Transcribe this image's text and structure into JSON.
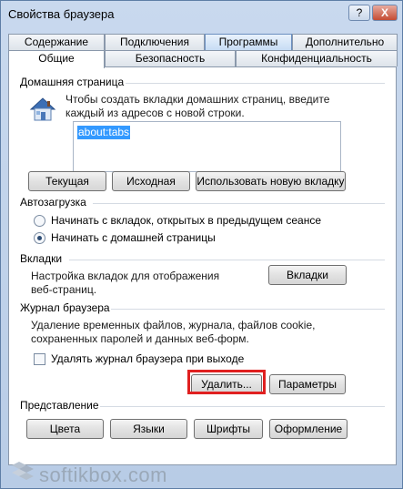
{
  "window": {
    "title": "Свойства браузера",
    "help_label": "?",
    "close_label": "X"
  },
  "tabs": {
    "row1": [
      "Содержание",
      "Подключения",
      "Программы",
      "Дополнительно"
    ],
    "row2": [
      "Общие",
      "Безопасность",
      "Конфиденциальность"
    ],
    "selected": "Общие"
  },
  "home": {
    "group_title": "Домашняя страница",
    "description": "Чтобы создать вкладки домашних страниц, введите каждый из адресов с новой строки.",
    "description_line1": "Чтобы создать вкладки домашних страниц, введите",
    "description_line2": "каждый из адресов с новой строки.",
    "url_value": "about:tabs",
    "btn_current": "Текущая",
    "btn_default": "Исходная",
    "btn_newtab": "Использовать новую вкладку"
  },
  "startup": {
    "group_title": "Автозагрузка",
    "option1": "Начинать с вкладок, открытых в предыдущем сеансе",
    "option2": "Начинать с домашней страницы",
    "selected": "option2"
  },
  "tabs_group": {
    "group_title": "Вкладки",
    "description_line1": "Настройка вкладок для отображения",
    "description_line2": "веб-страниц.",
    "btn_tabs": "Вкладки"
  },
  "history": {
    "group_title": "Журнал браузера",
    "description_line1": "Удаление временных файлов, журнала, файлов cookie,",
    "description_line2": "сохраненных паролей и данных веб-форм.",
    "checkbox_label": "Удалять журнал браузера при выходе",
    "checkbox_checked": false,
    "btn_delete": "Удалить...",
    "btn_settings": "Параметры"
  },
  "appearance": {
    "group_title": "Представление",
    "btn_colors": "Цвета",
    "btn_languages": "Языки",
    "btn_fonts": "Шрифты",
    "btn_design": "Оформление"
  },
  "watermark": {
    "text": "softikbox.com"
  },
  "colors": {
    "highlight_border": "#e02020",
    "selection": "#3399ff"
  }
}
